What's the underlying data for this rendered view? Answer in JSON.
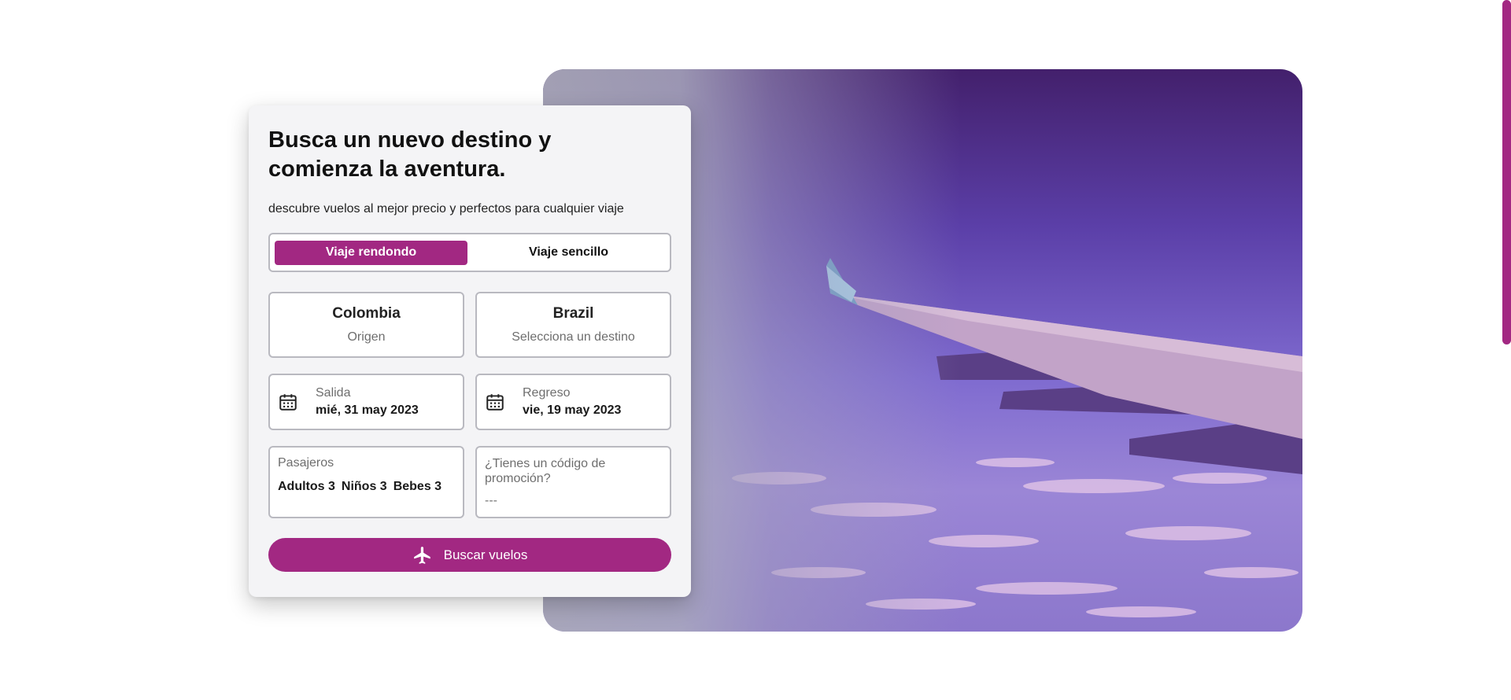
{
  "card": {
    "title": "Busca un nuevo destino y comienza la aventura.",
    "subtitle": "descubre vuelos al mejor precio y perfectos para cualquier viaje"
  },
  "trip_type": {
    "round_trip": "Viaje rendondo",
    "one_way": "Viaje sencillo",
    "selected": "round_trip"
  },
  "origin": {
    "name": "Colombia",
    "hint": "Origen"
  },
  "destination": {
    "name": "Brazil",
    "hint": "Selecciona un destino"
  },
  "departure": {
    "label": "Salida",
    "value": "mié, 31 may 2023",
    "icon": "calendar-icon"
  },
  "return": {
    "label": "Regreso",
    "value": "vie, 19 may 2023",
    "icon": "calendar-icon"
  },
  "passengers": {
    "label": "Pasajeros",
    "adults": "Adultos 3",
    "children": "Niños 3",
    "infants": "Bebes 3"
  },
  "promo": {
    "label": "¿Tienes un código de promoción?",
    "placeholder": "---"
  },
  "search_button": {
    "label": "Buscar vuelos",
    "icon": "airplane-icon"
  },
  "colors": {
    "accent": "#a22882",
    "card_bg": "#f4f4f6",
    "border": "#b9b9c0"
  }
}
